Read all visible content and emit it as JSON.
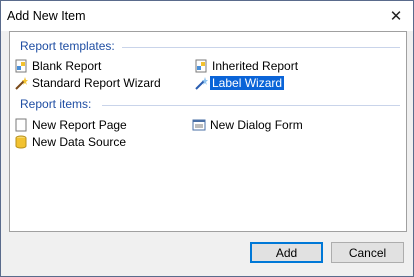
{
  "window": {
    "title": "Add New Item",
    "close_glyph": "✕"
  },
  "groups": {
    "report_templates": {
      "header": "Report templates:",
      "items": [
        {
          "label": "Blank Report",
          "icon": "blank-report-icon"
        },
        {
          "label": "Inherited Report",
          "icon": "inherited-report-icon"
        },
        {
          "label": "Standard Report Wizard",
          "icon": "wizard-wand-icon"
        },
        {
          "label": "Label Wizard",
          "icon": "label-wizard-wand-icon",
          "selected": true
        }
      ]
    },
    "report_items": {
      "header": "Report items:",
      "items": [
        {
          "label": "New Report Page",
          "icon": "report-page-icon"
        },
        {
          "label": "New Dialog Form",
          "icon": "dialog-form-icon"
        },
        {
          "label": "New Data Source",
          "icon": "data-source-icon"
        }
      ]
    }
  },
  "buttons": {
    "add": "Add",
    "cancel": "Cancel"
  },
  "colors": {
    "selection": "#0a64d8",
    "group_header": "#1f4ea3",
    "accent_border": "#0078d7"
  }
}
